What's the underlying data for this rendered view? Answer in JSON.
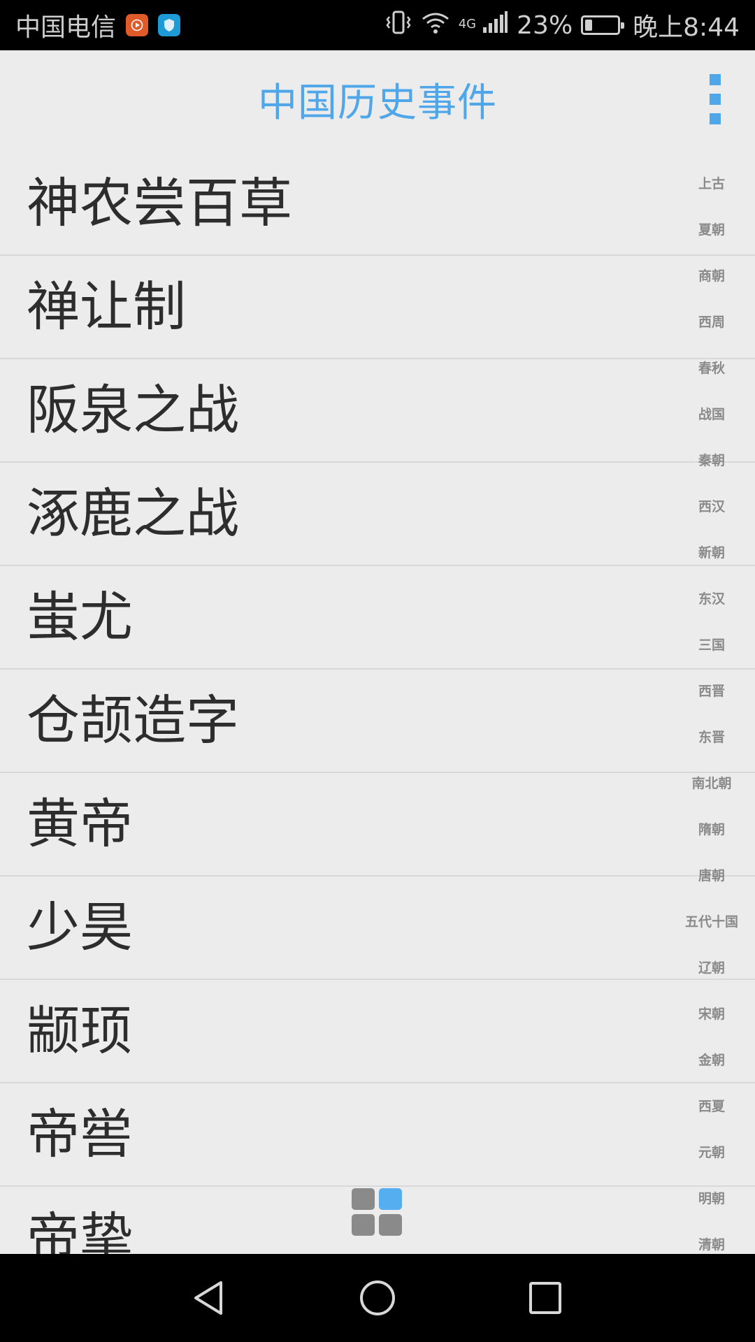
{
  "status_bar": {
    "carrier": "中国电信",
    "network": "4G",
    "battery_percent": "23%",
    "battery_level": 0.23,
    "time": "晚上8:44",
    "icons": [
      "video-notification-icon",
      "shield-notification-icon",
      "vibrate-icon",
      "wifi-icon",
      "signal-icon",
      "battery-icon"
    ]
  },
  "app_bar": {
    "title": "中国历史事件",
    "menu_icon": "overflow-menu-icon"
  },
  "events": [
    {
      "label": "神农尝百草"
    },
    {
      "label": "禅让制"
    },
    {
      "label": "阪泉之战"
    },
    {
      "label": "涿鹿之战"
    },
    {
      "label": "蚩尤"
    },
    {
      "label": "仓颉造字"
    },
    {
      "label": "黄帝"
    },
    {
      "label": "少昊"
    },
    {
      "label": "颛顼"
    },
    {
      "label": "帝喾"
    },
    {
      "label": "帝挚"
    }
  ],
  "dynasty_index": [
    "上古",
    "夏朝",
    "商朝",
    "西周",
    "春秋",
    "战国",
    "秦朝",
    "西汉",
    "新朝",
    "东汉",
    "三国",
    "西晋",
    "东晋",
    "南北朝",
    "隋朝",
    "唐朝",
    "五代十国",
    "辽朝",
    "宋朝",
    "金朝",
    "西夏",
    "元朝",
    "明朝",
    "清朝"
  ],
  "fab": {
    "icon": "grid-icon",
    "cell_colors": [
      "#8a8a8a",
      "#55aef0",
      "#8a8a8a",
      "#8a8a8a"
    ]
  },
  "nav_bar": {
    "icons": [
      "back-icon",
      "home-icon",
      "recents-icon"
    ]
  },
  "colors": {
    "accent": "#4fa7ea",
    "background": "#ececec",
    "divider": "#d8d8d8",
    "text": "#2d2d2d",
    "index_text": "#8a8a8a"
  }
}
